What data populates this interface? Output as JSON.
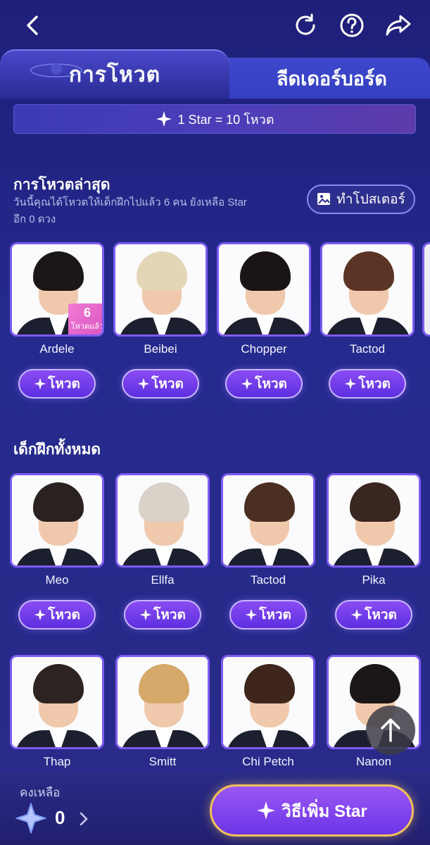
{
  "header": {
    "back_icon": "chevron-left-icon",
    "refresh_icon": "refresh-icon",
    "help_icon": "help-icon",
    "share_icon": "share-icon"
  },
  "tabs": [
    {
      "label": "การโหวต",
      "active": true
    },
    {
      "label": "ลีดเดอร์บอร์ด",
      "active": false
    }
  ],
  "rate": {
    "text": "1 Star = 10 โหวต"
  },
  "latest": {
    "title": "การโหวตล่าสุด",
    "subtitle_line1": "วันนี้คุณได้โหวตให้เด็กฝึกไปแล้ว 6 คน ยังเหลือ Star",
    "subtitle_line2": "อีก 0 ดวง",
    "poster_label": "ทำโปสเตอร์",
    "trainees": [
      {
        "name": "Ardele",
        "votes": "6",
        "votes_label": "โหวตแล้ว",
        "vote_label": "โหวต",
        "hair": "#1b1717"
      },
      {
        "name": "Beibei",
        "vote_label": "โหวต",
        "hair": "#e2d6b6"
      },
      {
        "name": "Chopper",
        "vote_label": "โหวต",
        "hair": "#1a1514"
      },
      {
        "name": "Tactod",
        "vote_label": "โหวต",
        "hair": "#5a3424"
      }
    ]
  },
  "all": {
    "title": "เด็กฝึกทั้งหมด",
    "trainees": [
      {
        "name": "Meo",
        "vote_label": "โหวต",
        "hair": "#2a2221"
      },
      {
        "name": "Ellfa",
        "vote_label": "โหวต",
        "hair": "#d8d2c8"
      },
      {
        "name": "Tactod",
        "vote_label": "โหวต",
        "hair": "#4b2e22"
      },
      {
        "name": "Pika",
        "vote_label": "โหวต",
        "hair": "#3a2620"
      },
      {
        "name": "Thap",
        "hair": "#2d2421"
      },
      {
        "name": "Smitt",
        "hair": "#d6a86a"
      },
      {
        "name": "Chi Petch",
        "hair": "#3e261c"
      },
      {
        "name": "Nanon",
        "hair": "#1b1716"
      }
    ]
  },
  "footer": {
    "remain_label": "คงเหลือ",
    "remain_value": "0",
    "how_label": "วิธีเพิ่ม Star"
  },
  "colors": {
    "accent": "#7d5cf0",
    "gold": "#f0c15a"
  }
}
